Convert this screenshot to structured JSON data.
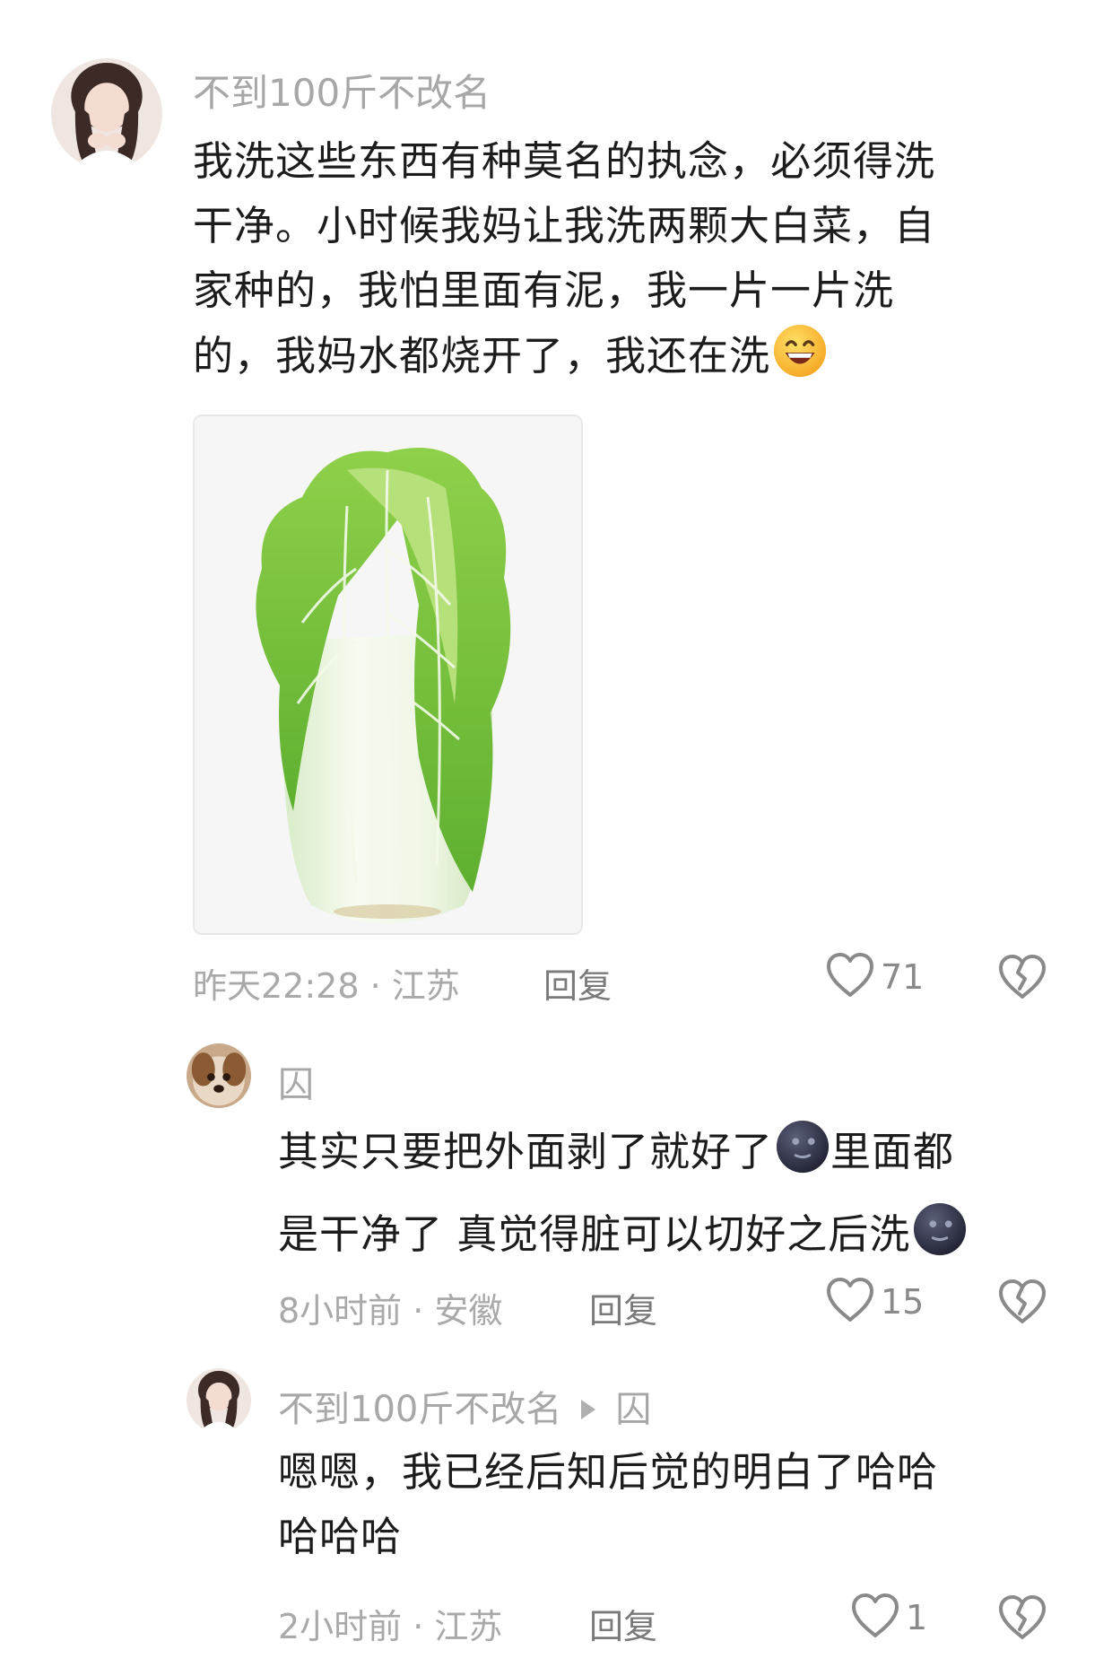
{
  "comments": [
    {
      "username": "不到100斤不改名",
      "lines": [
        "我洗这些东西有种莫名的执念，必须得洗",
        "干净。小时候我妈让我洗两颗大白菜，自",
        "家种的，我怕里面有泥，我一片一片洗",
        "的，我妈水都烧开了，我还在洗"
      ],
      "time_location": "昨天22:28 · 江苏",
      "reply_label": "回复",
      "likes": "71"
    },
    {
      "username": "囚",
      "lines": [
        "其实只要把外面剥了就好了",
        "里面都",
        "是干净了 真觉得脏可以切好之后洗"
      ],
      "time_location": "8小时前 · 安徽",
      "reply_label": "回复",
      "likes": "15"
    },
    {
      "username": "不到100斤不改名",
      "reply_to": "囚",
      "lines": [
        "嗯嗯，我已经后知后觉的明白了哈哈",
        "哈哈哈"
      ],
      "time_location": "2小时前 · 江苏",
      "reply_label": "回复",
      "likes": "1"
    }
  ],
  "icons": {
    "like": "heart-outline-icon",
    "dislike": "broken-heart-icon",
    "grin_emoji": "grinning-face-emoji",
    "moon_emoji": "new-moon-face-emoji",
    "reply_arrow": "triangle-right-icon"
  },
  "colors": {
    "username": "#a7a7a7",
    "text": "#1c1c1c",
    "meta": "#a9a9a9",
    "icon": "#8a8a8a"
  }
}
